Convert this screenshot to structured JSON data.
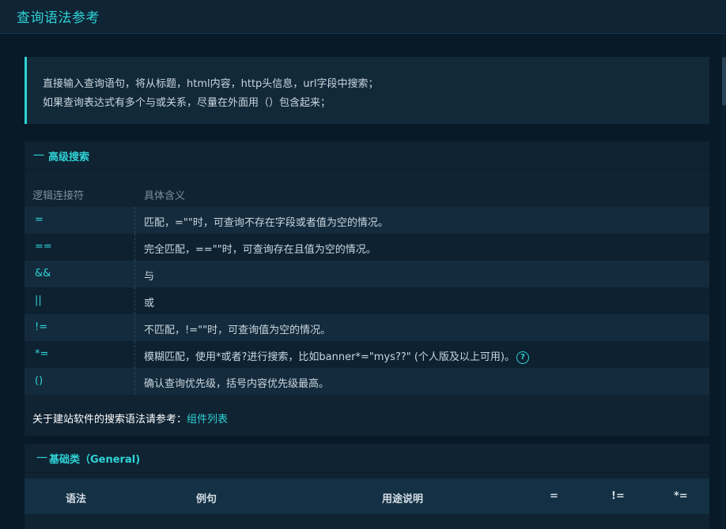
{
  "header": {
    "title": "查询语法参考"
  },
  "notice": {
    "line1": "直接输入查询语句，将从标题，html内容，http头信息，url字段中搜索；",
    "line2": "如果查询表达式有多个与或关系，尽量在外面用（）包含起来；"
  },
  "advanced": {
    "collapse_glyph": "一",
    "title": "高级搜索",
    "columns": {
      "operator": "逻辑连接符",
      "meaning": "具体含义"
    },
    "rows": [
      {
        "op": "=",
        "desc": "匹配，=\"\"时，可查询不存在字段或者值为空的情况。"
      },
      {
        "op": "==",
        "desc": "完全匹配，==\"\"时，可查询存在且值为空的情况。"
      },
      {
        "op": "&&",
        "desc": "与"
      },
      {
        "op": "||",
        "desc": "或"
      },
      {
        "op": "!=",
        "desc": "不匹配，!=\"\"时，可查询值为空的情况。"
      },
      {
        "op": "*=",
        "desc": "模糊匹配，使用*或者?进行搜索，比如banner*=\"mys??\" (个人版及以上可用)。"
      },
      {
        "op": "()",
        "desc": "确认查询优先级，括号内容优先级最高。"
      }
    ],
    "ref_text": "关于建站软件的搜索语法请参考：",
    "ref_link": "组件列表",
    "help_glyph": "?"
  },
  "general": {
    "collapse_glyph": "一",
    "title": "基础类（General)",
    "columns": {
      "syntax": "语法",
      "example": "例句",
      "usage": "用途说明",
      "eq": "=",
      "neq": "!=",
      "fuzzy": "*="
    }
  },
  "colors": {
    "accent": "#2fd3d6",
    "background": "#081a28",
    "panel": "#0f2333"
  }
}
